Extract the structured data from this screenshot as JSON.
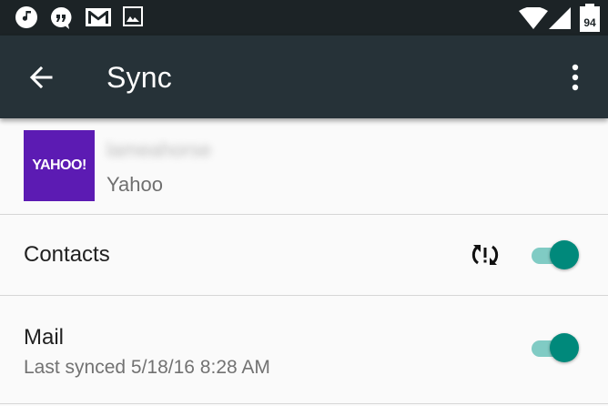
{
  "status_bar": {
    "battery_level": "94",
    "icons": [
      "music-note-icon",
      "quote-icon",
      "gmail-icon",
      "image-icon",
      "wifi-icon",
      "signal-icon",
      "battery-icon"
    ]
  },
  "toolbar": {
    "title": "Sync",
    "back_icon": "arrow-back-icon",
    "menu_icon": "more-vert-icon"
  },
  "account": {
    "logo_text": "YAHOO!",
    "username": "lameahorse",
    "type": "Yahoo"
  },
  "items": [
    {
      "label": "Contacts",
      "subtitle": "",
      "sync_icon": "sync-problem-icon",
      "enabled": true
    },
    {
      "label": "Mail",
      "subtitle": "Last synced 5/18/16 8:28 AM",
      "enabled": true
    }
  ],
  "colors": {
    "toolbar": "#263238",
    "status_bar": "#1c2326",
    "switch_thumb": "#00897b",
    "switch_track": "#80cbc4",
    "yahoo_purple": "#5c1bb3"
  }
}
